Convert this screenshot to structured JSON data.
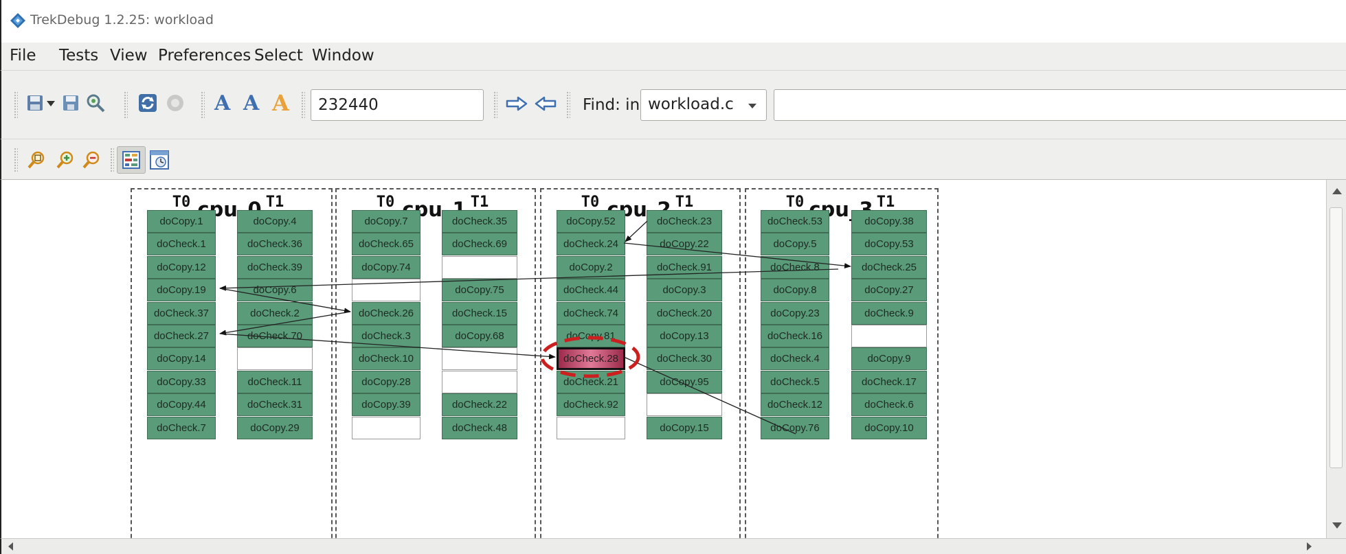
{
  "window": {
    "title": "TrekDebug 1.2.25: workload"
  },
  "menu": [
    {
      "label": "File"
    },
    {
      "label": "Tests"
    },
    {
      "label": "View"
    },
    {
      "label": "Preferences"
    },
    {
      "label": "Select"
    },
    {
      "label": "Window"
    }
  ],
  "toolbar": {
    "position_value": "232440",
    "find_label": "Find: in",
    "find_scope": "workload.c",
    "find_text": "",
    "font_buttons": [
      "A",
      "A",
      "A"
    ]
  },
  "cpus": [
    {
      "name": "cpu_0",
      "threads": [
        {
          "name": "T0",
          "cells": [
            "doCopy.1",
            "doCheck.1",
            "doCopy.12",
            "doCopy.19",
            "doCheck.37",
            "doCheck.27",
            "doCopy.14",
            "doCopy.33",
            "doCopy.44",
            "doCheck.7"
          ]
        },
        {
          "name": "T1",
          "cells": [
            "doCopy.4",
            "doCheck.36",
            "doCheck.39",
            "doCopy.6",
            "doCheck.2",
            "doCheck.70",
            "",
            "doCheck.11",
            "doCheck.31",
            "doCopy.29"
          ]
        }
      ]
    },
    {
      "name": "cpu_1",
      "threads": [
        {
          "name": "T0",
          "cells": [
            "doCopy.7",
            "doCheck.65",
            "doCopy.74",
            "",
            "doCheck.26",
            "doCheck.3",
            "doCheck.10",
            "doCopy.28",
            "doCopy.39",
            ""
          ]
        },
        {
          "name": "T1",
          "cells": [
            "doCheck.35",
            "doCheck.69",
            "",
            "doCopy.75",
            "doCheck.15",
            "doCopy.68",
            "",
            "",
            "doCheck.22",
            "doCheck.48"
          ]
        }
      ]
    },
    {
      "name": "cpu_2",
      "threads": [
        {
          "name": "T0",
          "cells": [
            "doCopy.52",
            "doCheck.24",
            "doCopy.2",
            "doCheck.44",
            "doCheck.74",
            "doCopy.81",
            "doCheck.28",
            "doCheck.21",
            "doCheck.92",
            ""
          ]
        },
        {
          "name": "T1",
          "cells": [
            "doCheck.23",
            "doCopy.22",
            "doCheck.91",
            "doCopy.3",
            "doCheck.20",
            "doCopy.13",
            "doCheck.30",
            "doCopy.95",
            "",
            "doCopy.15"
          ]
        }
      ]
    },
    {
      "name": "cpu_3",
      "threads": [
        {
          "name": "T0",
          "cells": [
            "doCheck.53",
            "doCopy.5",
            "doCheck.8",
            "doCopy.8",
            "doCopy.23",
            "doCheck.16",
            "doCheck.4",
            "doCheck.5",
            "doCheck.12",
            "doCopy.76"
          ]
        },
        {
          "name": "T1",
          "cells": [
            "doCopy.38",
            "doCopy.53",
            "doCheck.25",
            "doCopy.27",
            "doCheck.9",
            "",
            "doCopy.9",
            "doCheck.17",
            "doCheck.6",
            "doCopy.10"
          ]
        }
      ]
    }
  ],
  "selected_cell": "doCheck.28",
  "colors": {
    "cell_fill": "#5a9c7a",
    "selected": "#c23b64",
    "highlight_ring": "#cc1f1f"
  }
}
